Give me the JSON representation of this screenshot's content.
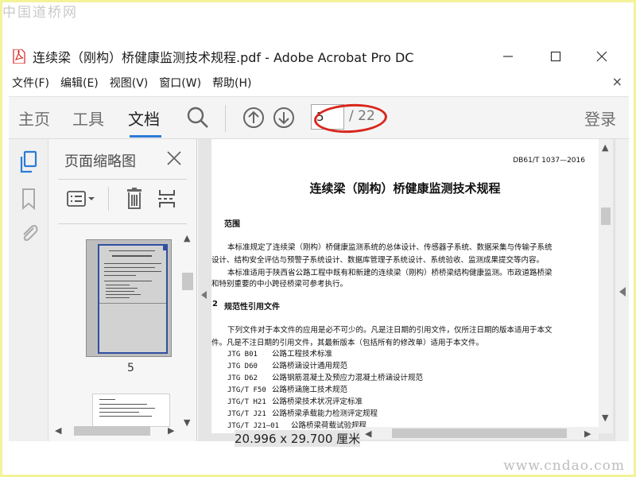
{
  "watermark": {
    "top": "中国道桥网",
    "bottom": "www.cndao.com"
  },
  "window": {
    "title": "连续梁（刚构）桥健康监测技术规程.pdf - Adobe Acrobat Pro DC",
    "icon": "pdf-file-icon"
  },
  "menu": {
    "items": [
      "文件(F)",
      "编辑(E)",
      "视图(V)",
      "窗口(W)",
      "帮助(H)"
    ],
    "close": "×"
  },
  "toolbar": {
    "tabs": [
      "主页",
      "工具",
      "文档"
    ],
    "active_tab": "文档",
    "current_page": "5",
    "total_pages": "/ 22",
    "login": "登录",
    "accent_color": "#2b7bd6",
    "highlight_color": "#d9261c"
  },
  "thumbnails": {
    "title": "页面缩略图",
    "page_label": "5"
  },
  "document": {
    "standard_no": "DB61/T 1037—2016",
    "title": "连续梁（刚构）桥健康监测技术规程",
    "heading1": "范围",
    "para1_line1": "本标准规定了连续梁（刚构）桥健康监测系统的总体设计、传感器子系统、数据采集与传输子系统",
    "para1_line2": "设计、结构安全评估与预警子系统设计、数据库管理子系统设计、系统验收、监测成果提交等内容。",
    "para2_line1": "本标准适用于陕西省公路工程中既有和新建的连续梁（刚构）桥桥梁结构健康监测。市政道路桥梁",
    "para2_line2": "和特别重要的中小跨径桥梁可参考执行。",
    "heading2_num": "2",
    "heading2": "规范性引用文件",
    "para3_line1": "下列文件对于本文件的应用是必不可少的。凡是注日期的引用文件，仅所注日期的版本适用于本文",
    "para3_line2": "件。凡是不注日期的引用文件，其最新版本（包括所有的修改单）适用于本文件。",
    "refs": [
      {
        "code": "JTG B01",
        "name": "公路工程技术标准"
      },
      {
        "code": "JTG D60",
        "name": "公路桥涵设计通用规范"
      },
      {
        "code": "JTG D62",
        "name": "公路钢筋混凝土及预应力混凝土桥涵设计规范"
      },
      {
        "code": "JTG/T F50",
        "name": "公路桥涵施工技术规范"
      },
      {
        "code": "JTG/T H21",
        "name": "公路桥梁技术状况评定标准"
      },
      {
        "code": "JTG/T J21",
        "name": "公路桥梁承载能力检测评定规程"
      },
      {
        "code": "JTG/T J21—01",
        "name": "公路桥梁荷载试验规程"
      }
    ],
    "page_size": "20.996 x 29.700 厘米"
  }
}
